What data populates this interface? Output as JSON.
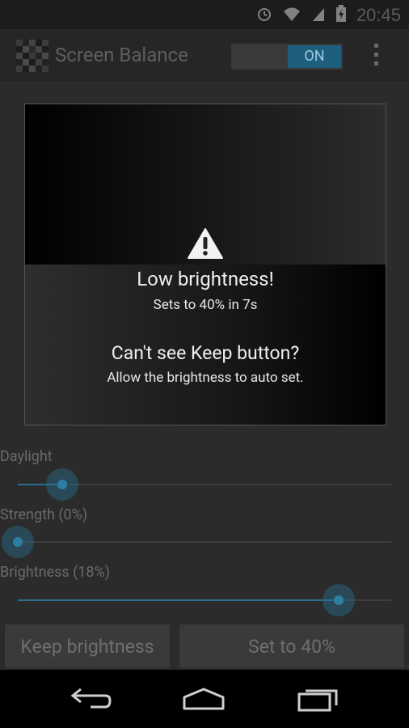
{
  "status": {
    "time": "20:45"
  },
  "app": {
    "title": "Screen Balance",
    "toggle_label": "ON"
  },
  "dialog": {
    "title": "Low brightness!",
    "subtitle": "Sets to 40% in 7s",
    "question": "Can't see Keep button?",
    "hint": "Allow the brightness to auto set."
  },
  "sliders": [
    {
      "label": "Daylight",
      "value_fraction": 0.12
    },
    {
      "label": "Strength (0%)",
      "value_fraction": 0.0
    },
    {
      "label": "Brightness (18%)",
      "value_fraction": 0.86
    }
  ],
  "buttons": {
    "keep": "Keep brightness",
    "set": "Set to 40%"
  },
  "colors": {
    "accent": "#2d7ea3",
    "toggle_on": "#1e5f7d"
  },
  "icons": [
    "alarm-icon",
    "wifi-icon",
    "signal-icon",
    "battery-charging-icon",
    "overflow-menu-icon",
    "warning-icon",
    "back-icon",
    "home-icon",
    "recents-icon"
  ]
}
